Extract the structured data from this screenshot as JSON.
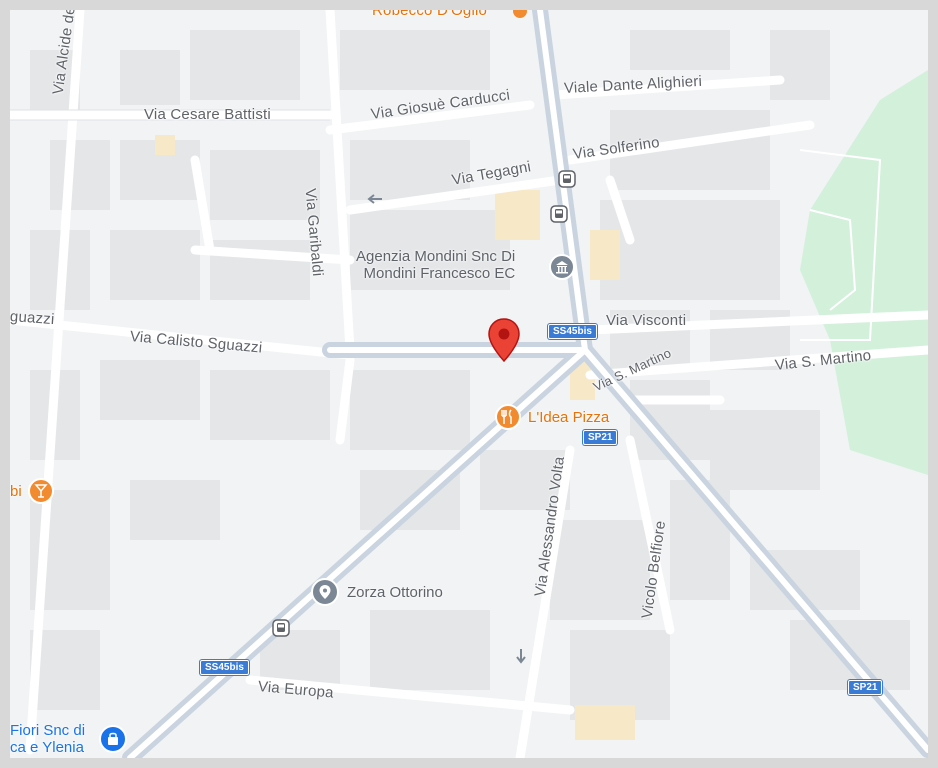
{
  "map": {
    "type": "street map",
    "colors": {
      "background": "#f1f3f4",
      "road": "#ffffff",
      "main_road": "#c9d4e0",
      "building": "#e4e6e8",
      "park": "#d3f0db",
      "pin": "#ea4335",
      "food": "#f28b30",
      "shield": "#3a7bd5"
    },
    "streets": [
      "Robecco D'Oglio",
      "Viale Dante Alighieri",
      "Via Alcide de Gasperi",
      "Via Cesare Battisti",
      "Via Giosuè Carducci",
      "Via Solferino",
      "Via Tegagni",
      "Via Garibaldi",
      "guazzi",
      "Via Calisto Sguazzi",
      "Via Visconti",
      "Via S. Martino",
      "Via S. Martino",
      "Via Alessandro Volta",
      "Vicolo Belfiore",
      "Via Europa"
    ],
    "poi": {
      "business": "Agenzia Mondini Snc Di",
      "business_2": "Mondini Francesco EC",
      "restaurant": "L'Idea Pizza",
      "bar_fragment": "bi",
      "place": "Zorza Ottorino",
      "shop_1": "Fiori Snc di",
      "shop_2": "ca e Ylenia"
    },
    "shields": {
      "ss45bis_a": "SS45bis",
      "sp21_a": "SP21",
      "ss45bis_b": "SS45bis",
      "sp21_b": "SP21"
    },
    "icons": {
      "pin": "location-pin-icon",
      "bus": "bus-stop-icon",
      "bank": "bank-icon",
      "restaurant": "restaurant-icon",
      "bar": "bar-icon",
      "place": "place-icon",
      "shop": "shopping-bag-icon"
    }
  }
}
